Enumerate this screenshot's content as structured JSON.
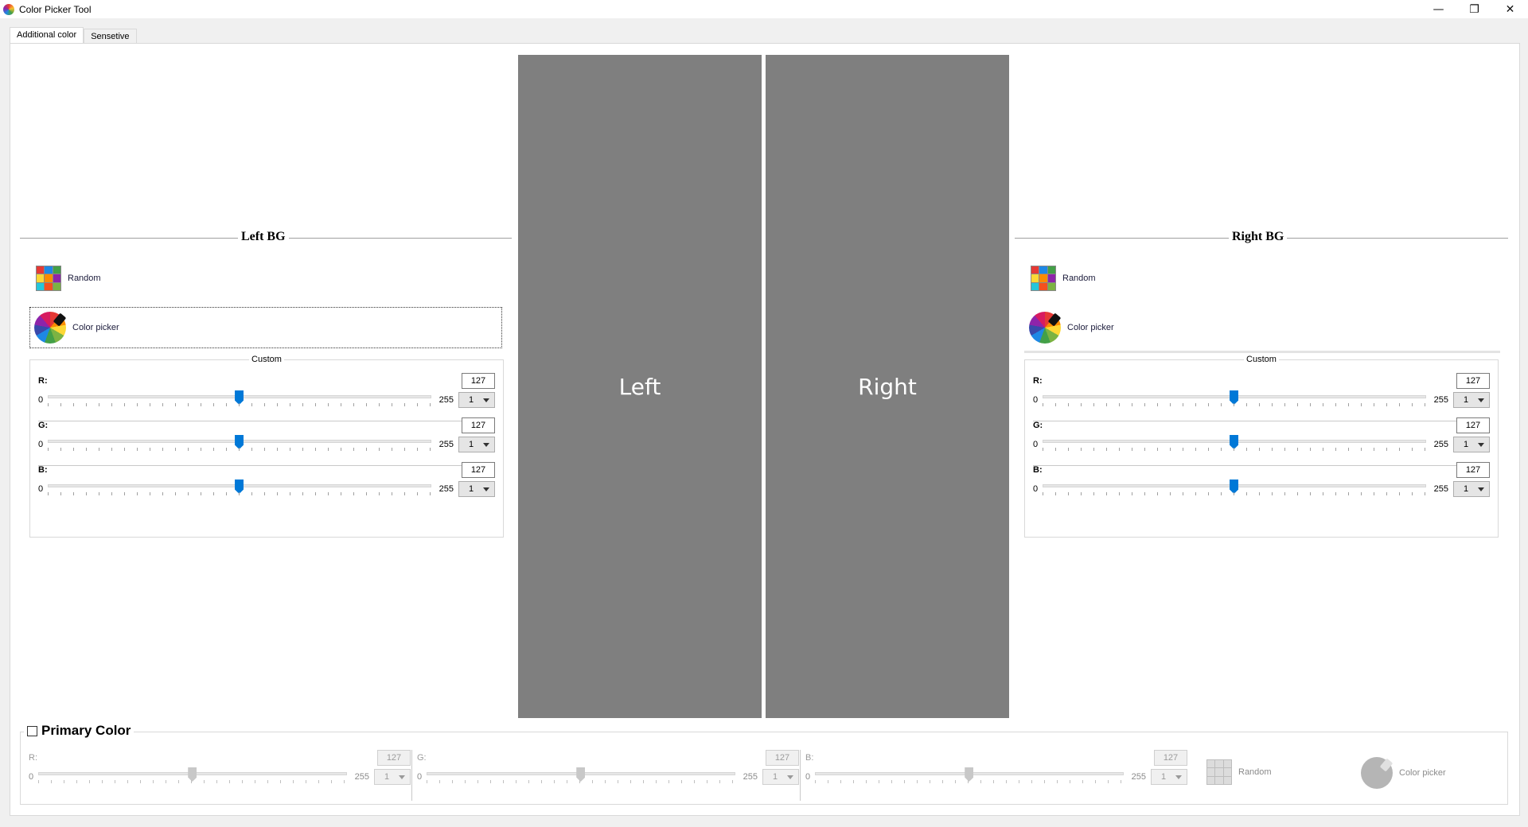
{
  "window": {
    "title": "Color Picker Tool",
    "minimize": "—",
    "restore": "❐",
    "close": "✕"
  },
  "tabs": [
    {
      "label": "Additional color"
    },
    {
      "label": "Sensetive"
    }
  ],
  "left": {
    "title": "Left BG",
    "random_label": "Random",
    "picker_label": "Color picker",
    "custom_title": "Custom",
    "channels": [
      {
        "label": "R:",
        "value": "127",
        "min": "0",
        "max": "255",
        "step": "1",
        "level": 0.498
      },
      {
        "label": "G:",
        "value": "127",
        "min": "0",
        "max": "255",
        "step": "1",
        "level": 0.498
      },
      {
        "label": "B:",
        "value": "127",
        "min": "0",
        "max": "255",
        "step": "1",
        "level": 0.498
      }
    ]
  },
  "right": {
    "title": "Right BG",
    "random_label": "Random",
    "picker_label": "Color picker",
    "custom_title": "Custom",
    "channels": [
      {
        "label": "R:",
        "value": "127",
        "min": "0",
        "max": "255",
        "step": "1",
        "level": 0.498
      },
      {
        "label": "G:",
        "value": "127",
        "min": "0",
        "max": "255",
        "step": "1",
        "level": 0.498
      },
      {
        "label": "B:",
        "value": "127",
        "min": "0",
        "max": "255",
        "step": "1",
        "level": 0.498
      }
    ]
  },
  "preview": {
    "left_label": "Left",
    "right_label": "Right",
    "color": "#7f7f7f"
  },
  "primary": {
    "title": "Primary Color",
    "checked": false,
    "random_label": "Random",
    "picker_label": "Color picker",
    "channels": [
      {
        "label": "R:",
        "value": "127",
        "min": "0",
        "max": "255",
        "step": "1",
        "level": 0.498
      },
      {
        "label": "G:",
        "value": "127",
        "min": "0",
        "max": "255",
        "step": "1",
        "level": 0.498
      },
      {
        "label": "B:",
        "value": "127",
        "min": "0",
        "max": "255",
        "step": "1",
        "level": 0.498
      }
    ]
  },
  "colors": {
    "accent": "#0078d7",
    "random_grid": [
      "#e53935",
      "#1e88e5",
      "#43a047",
      "#fdd835",
      "#fb8c00",
      "#8e24aa",
      "#26c6da",
      "#f4511e",
      "#7cb342"
    ]
  }
}
